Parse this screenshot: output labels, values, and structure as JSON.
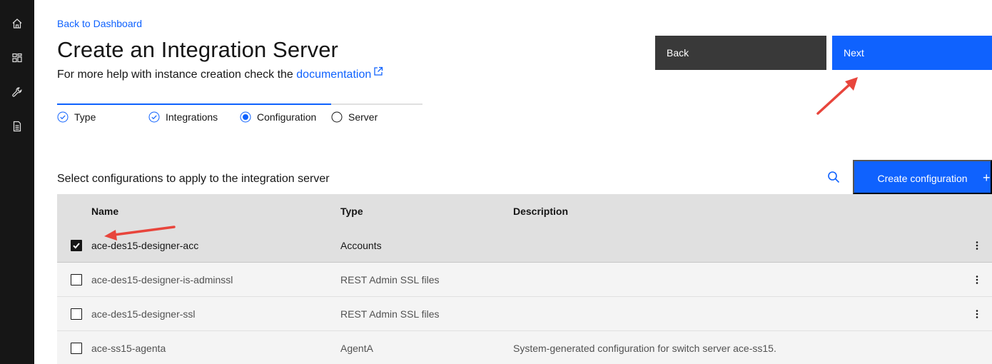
{
  "nav": {
    "icons": [
      "home-icon",
      "dashboard-icon",
      "wrench-icon",
      "document-icon"
    ]
  },
  "header": {
    "back_link": "Back to Dashboard",
    "title": "Create an Integration Server",
    "help_prefix": "For more help with instance creation check the",
    "help_link": "documentation"
  },
  "actions": {
    "back_label": "Back",
    "next_label": "Next"
  },
  "progress": {
    "steps": [
      {
        "label": "Type",
        "state": "complete"
      },
      {
        "label": "Integrations",
        "state": "complete"
      },
      {
        "label": "Configuration",
        "state": "current"
      },
      {
        "label": "Server",
        "state": "incomplete"
      }
    ]
  },
  "configs": {
    "section_label": "Select configurations to apply to the integration server",
    "create_label": "Create configuration",
    "create_icon": "+",
    "columns": [
      "Name",
      "Type",
      "Description"
    ],
    "rows": [
      {
        "name": "ace-des15-designer-acc",
        "type": "Accounts",
        "description": "",
        "checked": true
      },
      {
        "name": "ace-des15-designer-is-adminssl",
        "type": "REST Admin SSL files",
        "description": "",
        "checked": false
      },
      {
        "name": "ace-des15-designer-ssl",
        "type": "REST Admin SSL files",
        "description": "",
        "checked": false
      },
      {
        "name": "ace-ss15-agenta",
        "type": "AgentA",
        "description": "System-generated configuration for switch server ace-ss15.",
        "checked": false
      }
    ]
  },
  "colors": {
    "primary": "#0f62fe",
    "secondary": "#393939",
    "sidenav": "#161616",
    "annotation_arrow": "#e8453c"
  }
}
